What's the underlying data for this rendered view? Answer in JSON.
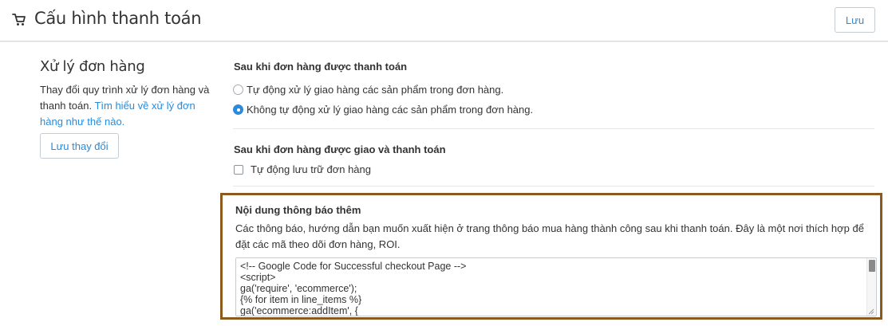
{
  "header": {
    "title": "Cấu hình thanh toán",
    "save_label": "Lưu",
    "icon": "cart-icon"
  },
  "sidebar": {
    "title": "Xử lý đơn hàng",
    "desc_text": "Thay đổi quy trình xử lý đơn hàng và thanh toán.",
    "link_text": "Tìm hiểu về xử lý đơn hàng như thế nào.",
    "save_changes_label": "Lưu thay đổi"
  },
  "after_paid": {
    "title": "Sau khi đơn hàng được thanh toán",
    "options": [
      {
        "label": "Tự động xử lý giao hàng các sản phẩm trong đơn hàng.",
        "selected": false
      },
      {
        "label": "Không tự động xử lý giao hàng các sản phẩm trong đơn hàng.",
        "selected": true
      }
    ]
  },
  "after_delivered": {
    "title": "Sau khi đơn hàng được giao và thanh toán",
    "checkbox_label": "Tự động lưu trữ đơn hàng",
    "checked": false
  },
  "notification": {
    "title": "Nội dung thông báo thêm",
    "desc": "Các thông báo, hướng dẫn bạn muốn xuất hiện ở trang thông báo mua hàng thành công sau khi thanh toán. Đây là một nơi thích hợp để đặt các mã theo dõi đơn hàng, ROI.",
    "code": "<!-- Google Code for Successful checkout Page -->\n<script>\nga('require', 'ecommerce');\n{% for item in line_items %}\nga('ecommerce:addItem', {"
  },
  "colors": {
    "accent": "#2c8ad8",
    "highlight_border": "#8b5a1e",
    "background": "#ebeef0"
  }
}
